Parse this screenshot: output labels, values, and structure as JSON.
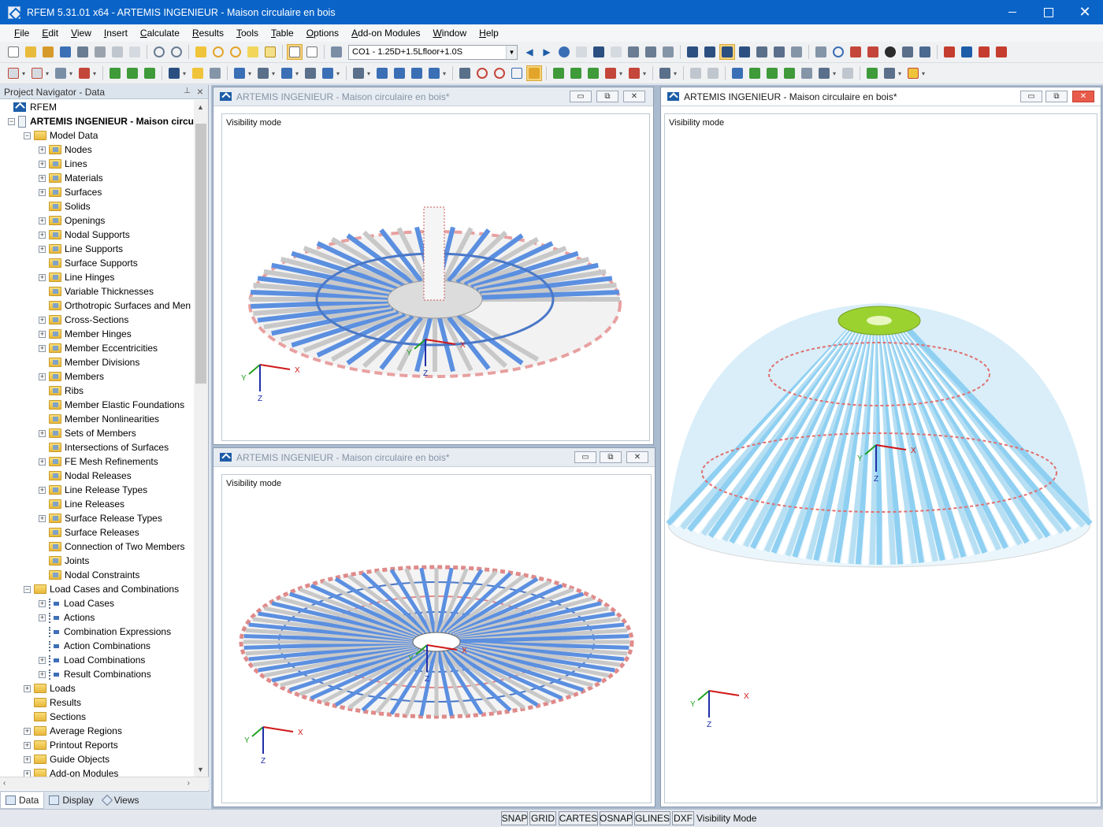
{
  "window": {
    "title": "RFEM 5.31.01 x64 - ARTEMIS INGENIEUR - Maison circulaire en bois",
    "min_icon": "minimize-icon",
    "max_icon": "maximize-icon",
    "close_icon": "close-icon",
    "close_glyph": "✕"
  },
  "menu": [
    "File",
    "Edit",
    "View",
    "Insert",
    "Calculate",
    "Results",
    "Tools",
    "Table",
    "Options",
    "Add-on Modules",
    "Window",
    "Help"
  ],
  "toolbar": {
    "load_combo": "CO1 - 1.25D+1.5Lfloor+1.0S"
  },
  "navigator": {
    "title": "Project Navigator - Data",
    "pin_glyph": "📌",
    "close_glyph": "×",
    "root": "RFEM",
    "project": "ARTEMIS INGENIEUR - Maison circu",
    "model_data": "Model Data",
    "model_items": [
      "Nodes",
      "Lines",
      "Materials",
      "Surfaces",
      "Solids",
      "Openings",
      "Nodal Supports",
      "Line Supports",
      "Surface Supports",
      "Line Hinges",
      "Variable Thicknesses",
      "Orthotropic Surfaces and Men",
      "Cross-Sections",
      "Member Hinges",
      "Member Eccentricities",
      "Member Divisions",
      "Members",
      "Ribs",
      "Member Elastic Foundations",
      "Member Nonlinearities",
      "Sets of Members",
      "Intersections of Surfaces",
      "FE Mesh Refinements",
      "Nodal Releases",
      "Line Release Types",
      "Line Releases",
      "Surface Release Types",
      "Surface Releases",
      "Connection of Two Members",
      "Joints",
      "Nodal Constraints"
    ],
    "load_group": "Load Cases and Combinations",
    "load_items": [
      "Load Cases",
      "Actions",
      "Combination Expressions",
      "Action Combinations",
      "Load Combinations",
      "Result Combinations"
    ],
    "top_items": [
      "Loads",
      "Results",
      "Sections",
      "Average Regions",
      "Printout Reports",
      "Guide Objects",
      "Add-on Modules"
    ],
    "tabs": [
      "Data",
      "Display",
      "Views"
    ]
  },
  "views": {
    "inactive_title": "ARTEMIS INGENIEUR - Maison circulaire en bois*",
    "active_title": "ARTEMIS INGENIEUR - Maison circulaire en bois*",
    "visibility_label": "Visibility mode",
    "axis_x": "X",
    "axis_y": "Y",
    "axis_z": "Z",
    "btn_min": "▭",
    "btn_restore": "⧉",
    "btn_close": "✕"
  },
  "status": {
    "buttons": [
      "SNAP",
      "GRID",
      "CARTES",
      "OSNAP",
      "GLINES",
      "DXF"
    ],
    "mode": "Visibility Mode"
  },
  "colors": {
    "beam_blue": "#5b8fe0",
    "beam_grey": "#c8c8c8",
    "dome_light": "#8fd0f2",
    "dome_top": "#9bd230",
    "ring_red": "#e07070"
  }
}
